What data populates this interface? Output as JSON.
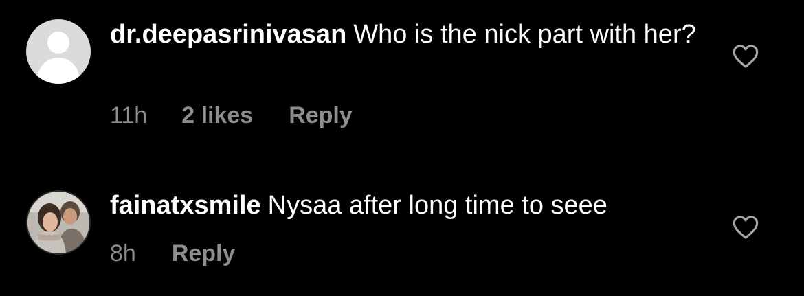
{
  "comments": [
    {
      "username": "dr.deepasrinivasan",
      "text": "Who is the nick part with her?",
      "time": "11h",
      "likes": "2 likes",
      "reply_label": "Reply",
      "avatar": "default-avatar-icon"
    },
    {
      "username": "fainatxsmile",
      "text": "Nysaa after long time to seee",
      "time": "8h",
      "reply_label": "Reply",
      "avatar": "profile-photo"
    }
  ],
  "colors": {
    "background": "#000000",
    "text": "#ffffff",
    "meta": "#8e8e8e",
    "heart": "#a8a8a8"
  }
}
